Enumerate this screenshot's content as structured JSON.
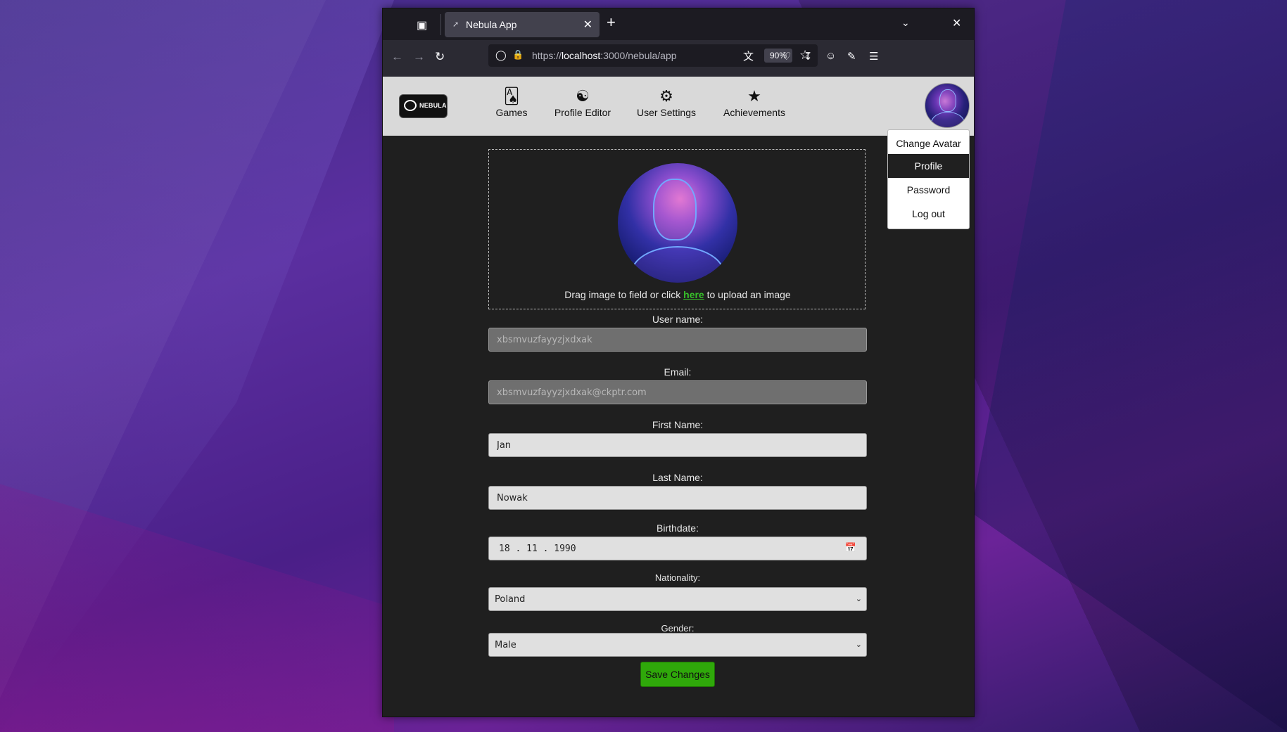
{
  "browser": {
    "tab_title": "Nebula App",
    "tab_favicon": "rocket-icon",
    "url_prefix": "https://",
    "url_host": "localhost",
    "url_rest": ":3000/nebula/app",
    "zoom": "90%"
  },
  "app": {
    "logo_text": "NEBULA",
    "nav": [
      {
        "label": "Games",
        "icon": "cards-icon"
      },
      {
        "label": "Profile Editor",
        "icon": "profile-editor-icon"
      },
      {
        "label": "User Settings",
        "icon": "gear-icon"
      },
      {
        "label": "Achievements",
        "icon": "star-icon"
      }
    ],
    "user_menu": {
      "items": [
        "Change Avatar",
        "Profile",
        "Password",
        "Log out"
      ],
      "active": "Profile"
    }
  },
  "form": {
    "drop_text_before": "Drag image to field or click ",
    "drop_link": "here",
    "drop_text_after": " to upload an image",
    "username_label": "User name:",
    "username_value": "xbsmvuzfayyzjxdxak",
    "email_label": "Email:",
    "email_value": "xbsmvuzfayyzjxdxak@ckptr.com",
    "firstname_label": "First Name:",
    "firstname_value": "Jan",
    "lastname_label": "Last Name:",
    "lastname_value": "Nowak",
    "birthdate_label": "Birthdate:",
    "birthdate_value": "18 . 11 . 1990",
    "nationality_label": "Nationality:",
    "nationality_value": "Poland",
    "gender_label": "Gender:",
    "gender_value": "Male",
    "save_label": "Save Changes"
  },
  "colors": {
    "accent_green": "#2fa80a",
    "link_green": "#37c02a",
    "page_bg": "#1f1f1f",
    "header_bg": "#d9d9d9"
  }
}
